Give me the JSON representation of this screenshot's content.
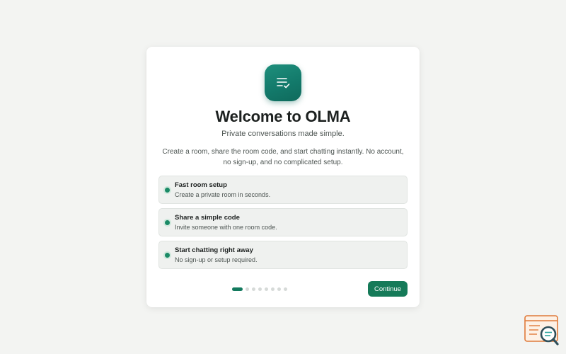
{
  "onboarding": {
    "title": "Welcome to OLMA",
    "subtitle": "Private conversations made simple.",
    "description": "Create a room, share the room code, and start chatting instantly. No account, no sign-up, and no complicated setup.",
    "features": [
      {
        "title": "Fast room setup",
        "description": "Create a private room in seconds."
      },
      {
        "title": "Share a simple code",
        "description": "Invite someone with one room code."
      },
      {
        "title": "Start chatting right away",
        "description": "No sign-up or setup required."
      }
    ],
    "pager": {
      "current_step": 1,
      "total_steps": 8
    },
    "continue_label": "Continue"
  },
  "icons": {
    "app": "checklist-icon",
    "corner": "search-document-icon"
  },
  "colors": {
    "accent": "#157a58",
    "icon_gradient_start": "#1e8f7c",
    "icon_gradient_end": "#0f6a5c",
    "background": "#f3f4f2",
    "badge_orange": "#e07a3a"
  }
}
